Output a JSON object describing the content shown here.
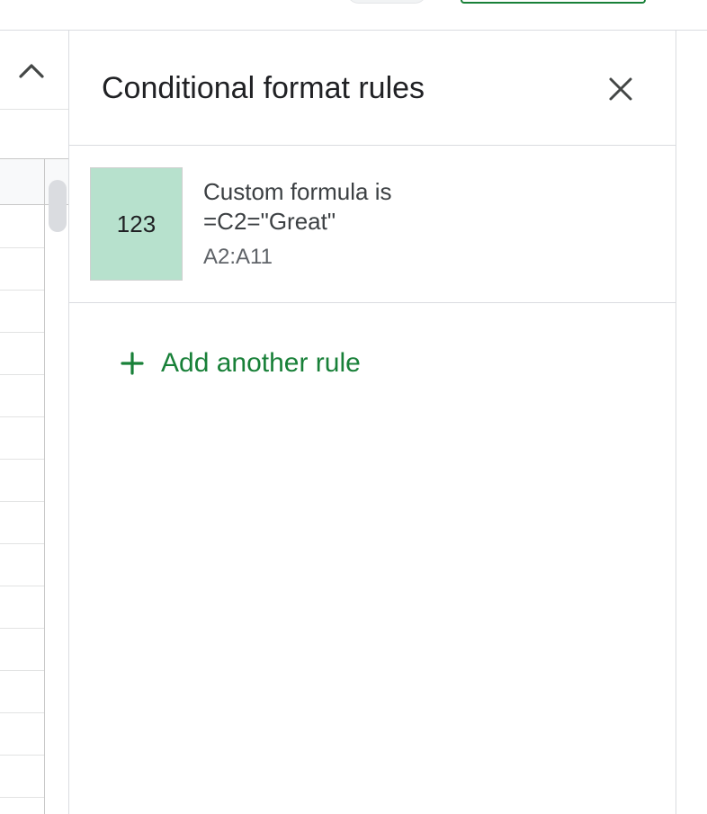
{
  "panel": {
    "title": "Conditional format rules",
    "close_icon": "close-icon"
  },
  "rule": {
    "preview_text": "123",
    "preview_color": "#b7e1cd",
    "condition": "Custom formula is",
    "formula": "=C2=\"Great\"",
    "range": "A2:A11"
  },
  "add_rule": {
    "icon": "plus-icon",
    "label": "Add another rule",
    "color": "#188038"
  },
  "sheet": {
    "collapse_icon": "chevron-up-icon"
  }
}
